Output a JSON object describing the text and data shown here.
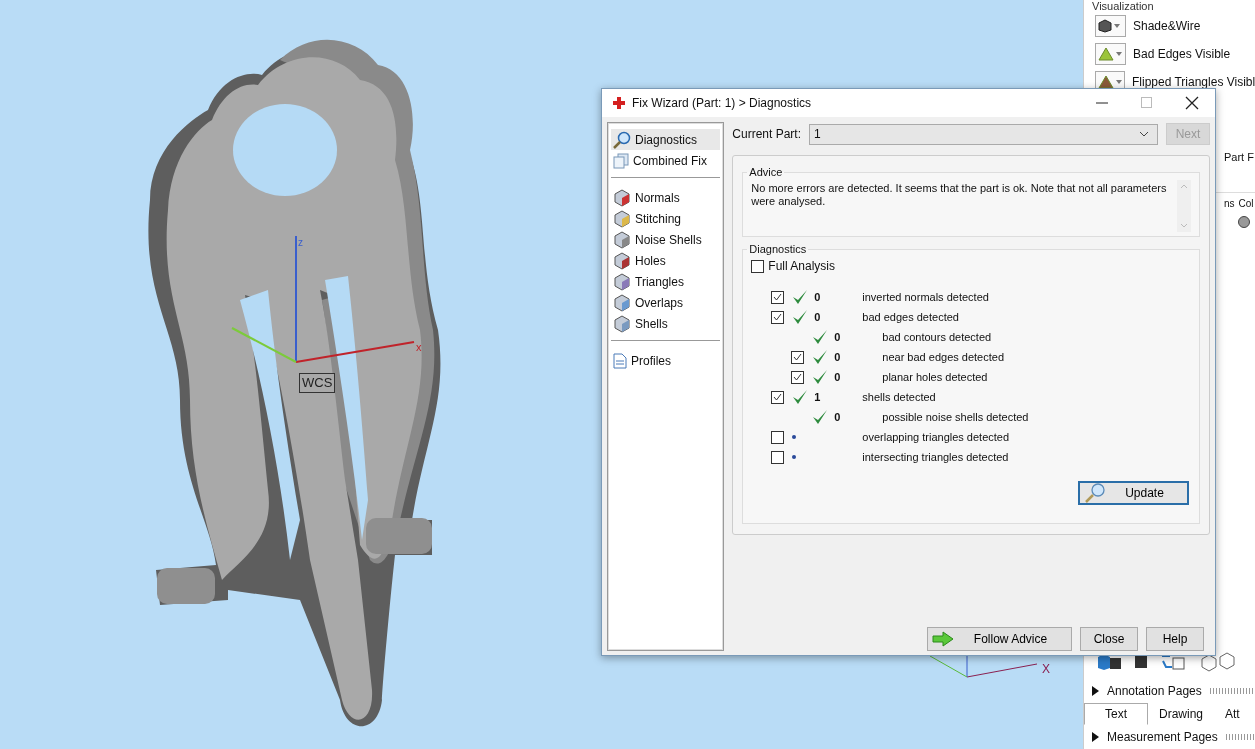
{
  "viewport": {
    "axis_labels": [
      "z",
      "x"
    ],
    "wcs_label": "WCS",
    "mini_axis_label": "X"
  },
  "side_panel": {
    "section_title": "Visualization",
    "view_options": [
      {
        "label": "Shade&Wire"
      },
      {
        "label": "Bad Edges Visible"
      },
      {
        "label": "Flipped Triangles Visibl"
      }
    ],
    "part_tab": "Part F",
    "column_headers": [
      "ns",
      "Col"
    ],
    "sections": [
      {
        "label": "Annotation Pages",
        "expanded": false,
        "tabs": [
          {
            "label": "Text",
            "selected": true
          },
          {
            "label": "Drawing",
            "selected": false
          },
          {
            "label": "Att",
            "selected": false
          }
        ]
      },
      {
        "label": "Measurement Pages",
        "expanded": false
      }
    ]
  },
  "dialog": {
    "title": "Fix Wizard (Part: 1) > Diagnostics",
    "nav_groups": [
      [
        {
          "label": "Diagnostics",
          "selected": true
        },
        {
          "label": "Combined Fix",
          "selected": false
        }
      ],
      [
        {
          "label": "Normals",
          "selected": false
        },
        {
          "label": "Stitching",
          "selected": false
        },
        {
          "label": "Noise Shells",
          "selected": false
        },
        {
          "label": "Holes",
          "selected": false
        },
        {
          "label": "Triangles",
          "selected": false
        },
        {
          "label": "Overlaps",
          "selected": false
        },
        {
          "label": "Shells",
          "selected": false
        }
      ],
      [
        {
          "label": "Profiles",
          "selected": false
        }
      ]
    ],
    "current_part": {
      "label": "Current Part:",
      "value": "1"
    },
    "next_button": {
      "label": "Next",
      "disabled": true
    },
    "advice": {
      "title": "Advice",
      "text": "No more errors are detected. It seems that the part is ok. Note that not all parameters were analysed."
    },
    "diagnostics": {
      "title": "Diagnostics",
      "full_analysis": {
        "label": "Full Analysis",
        "checked": false
      },
      "checks": [
        {
          "kind": "checkbox",
          "checked": true,
          "passed": true,
          "count": "0",
          "label": "inverted normals detected"
        },
        {
          "kind": "checkbox",
          "checked": true,
          "passed": true,
          "count": "0",
          "label": "bad edges detected",
          "children": [
            {
              "kind": "plain",
              "passed": true,
              "count": "0",
              "label": "bad contours detected"
            },
            {
              "kind": "checkbox",
              "checked": true,
              "passed": true,
              "count": "0",
              "label": "near bad edges detected"
            },
            {
              "kind": "checkbox",
              "checked": true,
              "passed": true,
              "count": "0",
              "label": "planar holes detected"
            }
          ]
        },
        {
          "kind": "checkbox",
          "checked": true,
          "passed": true,
          "count": "1",
          "label": "shells detected",
          "children": [
            {
              "kind": "plain",
              "passed": true,
              "count": "0",
              "label": "possible noise shells detected"
            }
          ]
        },
        {
          "kind": "checkbox",
          "checked": false,
          "passed": false,
          "label": "overlapping triangles detected"
        },
        {
          "kind": "checkbox",
          "checked": false,
          "passed": false,
          "label": "intersecting triangles detected"
        }
      ],
      "update_button": "Update"
    },
    "buttons": [
      "Follow Advice",
      "Close",
      "Help"
    ]
  }
}
